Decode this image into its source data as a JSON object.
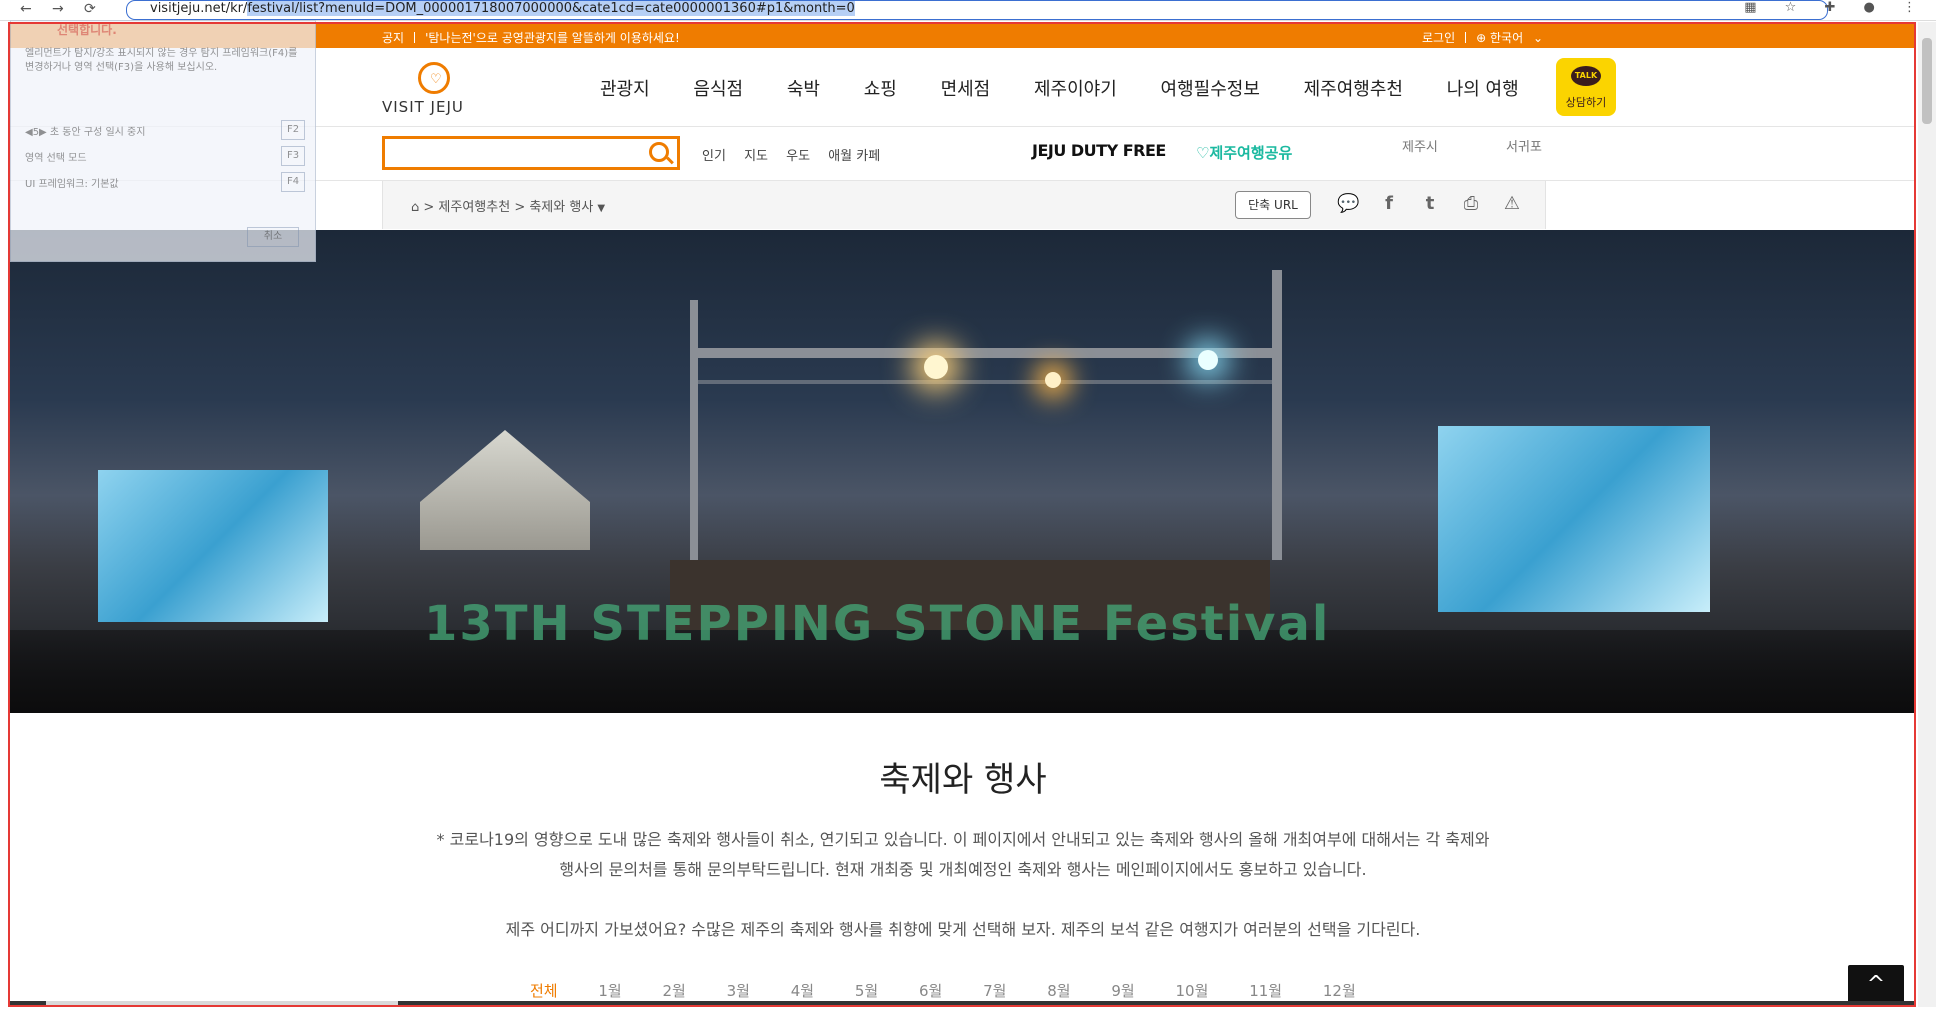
{
  "browser": {
    "url_prefix": "visitjeju.net/kr/",
    "url_selected": "festival/list?menuId=DOM_000001718007000000&cate1cd=cate0000001360#p1&month=0"
  },
  "notice": {
    "label": "공지",
    "text": "'탐나는전'으로 공영관광지를 알뜰하게 이용하세요!",
    "login": "로그인",
    "language": "한국어"
  },
  "logo": {
    "text": "VISIT JEJU"
  },
  "gnb": [
    "관광지",
    "음식점",
    "숙박",
    "쇼핑",
    "면세점",
    "제주이야기",
    "여행필수정보",
    "제주여행추천",
    "나의 여행"
  ],
  "kakao": {
    "badge": "TALK",
    "label": "상담하기"
  },
  "search": {
    "placeholder": ""
  },
  "quick_links": [
    "인기",
    "지도",
    "우도",
    "애월 카페"
  ],
  "banners": {
    "dutyfree": "JEJU DUTY FREE",
    "share": "제주여행공유"
  },
  "regions": [
    "제주시",
    "서귀포"
  ],
  "breadcrumb": {
    "path": "> 제주여행추천 > 축제와 행사"
  },
  "short_url": "단축 URL",
  "accessibility": {
    "title": "선택합니다.",
    "desc": "엘리먼트가 탐지/강조 표시되지 않는 경우 탐지 프레임워크(F4)를 변경하거나 영역 선택(F3)을 사용해 보십시오.",
    "row1": "◀5▶ 초 동안 구성 일시 중지",
    "row1_key": "F2",
    "row2": "영역 선택 모드",
    "row2_key": "F3",
    "row3": "UI 프레임워크: 기본값",
    "row3_key": "F4",
    "cancel": "취소"
  },
  "hero": {
    "caption": "13TH STEPPING STONE Festival"
  },
  "page": {
    "title": "축제와 행사",
    "desc1": "* 코로나19의 영향으로 도내 많은 축제와 행사들이 취소, 연기되고 있습니다. 이 페이지에서 안내되고 있는 축제와 행사의 올해 개최여부에 대해서는 각 축제와",
    "desc2": "행사의 문의처를 통해 문의부탁드립니다. 현재 개최중 및 개최예정인 축제와 행사는 메인페이지에서도 홍보하고 있습니다.",
    "desc3": "제주 어디까지 가보셨어요? 수많은 제주의 축제와 행사를 취향에 맞게 선택해 보자. 제주의 보석 같은 여행지가 여러분의 선택을 기다린다."
  },
  "months": [
    "전체",
    "1월",
    "2월",
    "3월",
    "4월",
    "5월",
    "6월",
    "7월",
    "8월",
    "9월",
    "10월",
    "11월",
    "12월"
  ],
  "colors": {
    "accent": "#ef7c00",
    "outline": "#e53935",
    "kakao": "#fbd400"
  }
}
